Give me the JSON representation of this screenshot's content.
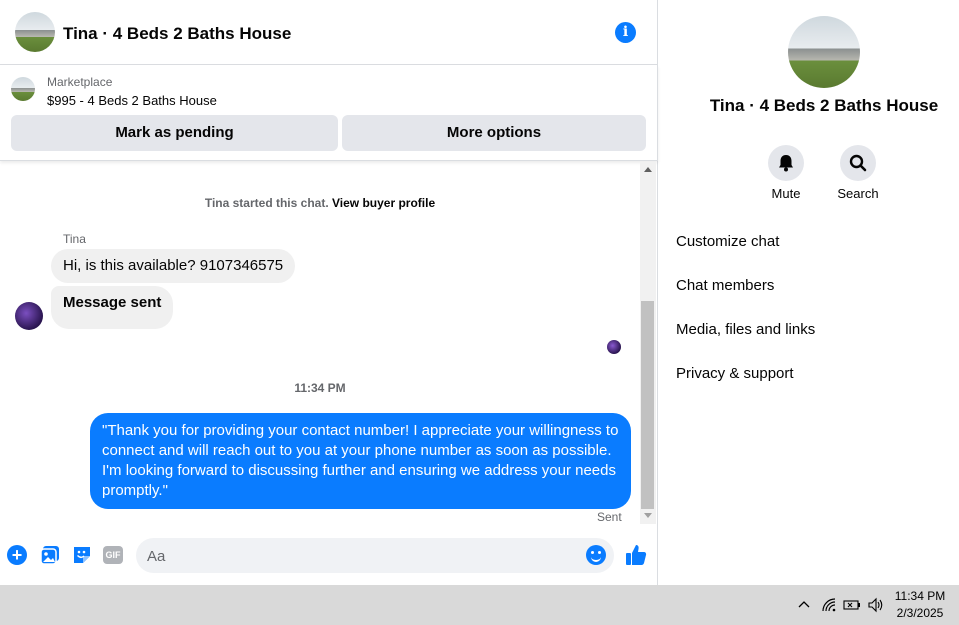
{
  "header": {
    "title": "Tina · 4 Beds 2 Baths House",
    "info_icon": "info-icon"
  },
  "marketplace": {
    "label": "Marketplace",
    "listing": "$995 - 4 Beds 2 Baths House",
    "mark_pending": "Mark as pending",
    "more_options": "More options"
  },
  "thread": {
    "started_prefix": "Tina started this chat. ",
    "view_buyer_profile": "View buyer profile",
    "sender_name": "Tina",
    "messages_in": [
      "Hi, is this available? 9107346575",
      "Message sent"
    ],
    "timestamp": "11:34 PM",
    "message_out": "\"Thank you for providing your contact number! I appreciate your willingness to connect and will reach out to you at your phone number as soon as possible. I'm looking forward to discussing further and ensuring we address your needs promptly.\"",
    "status": "Sent"
  },
  "composer": {
    "placeholder": "Aa",
    "gif_label": "GIF"
  },
  "panel": {
    "name": "Tina · 4 Beds 2 Baths House",
    "mute": "Mute",
    "search": "Search",
    "items": [
      "Customize chat",
      "Chat members",
      "Media, files and links",
      "Privacy & support"
    ]
  },
  "taskbar": {
    "time": "11:34 PM",
    "date": "2/3/2025"
  },
  "colors": {
    "accent": "#0a7cff",
    "bubble_in": "#f0f0f0",
    "button_bg": "#e4e6eb"
  }
}
